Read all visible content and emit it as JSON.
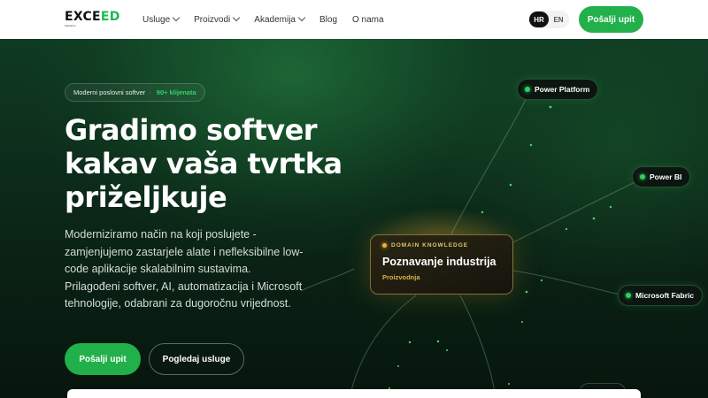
{
  "header": {
    "logo_text": "EXCEED",
    "logo_subtext": "Solutions",
    "nav": [
      {
        "label": "Usluge",
        "has_dropdown": true
      },
      {
        "label": "Proizvodi",
        "has_dropdown": true
      },
      {
        "label": "Akademija",
        "has_dropdown": true
      },
      {
        "label": "Blog",
        "has_dropdown": false
      },
      {
        "label": "O nama",
        "has_dropdown": false
      }
    ],
    "languages": [
      {
        "label": "HR",
        "active": true
      },
      {
        "label": "EN",
        "active": false
      }
    ],
    "cta_label": "Pošalji upit"
  },
  "hero": {
    "badge_text": "Moderni poslovni softver",
    "badge_separator": "·",
    "badge_highlight": "90+ klijenata",
    "title": "Gradimo softver kakav vaša tvrtka priželjkuje",
    "description": "Moderniziramo način na koji poslujete - zamjenjujemo zastarjele alate i nefleksibilne low-code aplikacije skalabilnim sustavima. Prilagođeni softver, AI, automatizacija i Microsoft tehnologije, odabrani za dugoročnu vrijednost.",
    "primary_button": "Pošalji upit",
    "secondary_button": "Pogledaj usluge"
  },
  "diagram": {
    "nodes": [
      {
        "label": "Power Platform"
      },
      {
        "label": "Power BI"
      },
      {
        "label": "Microsoft Fabric"
      }
    ],
    "card": {
      "kicker": "DOMAIN KNOWLEDGE",
      "title": "Poznavanje industrija",
      "subtitle": "Proizvodnja"
    }
  },
  "colors": {
    "accent_green": "#22b04b",
    "badge_highlight": "#34d36a",
    "card_gold": "#e7c56a",
    "hero_dark": "#0b2416"
  }
}
